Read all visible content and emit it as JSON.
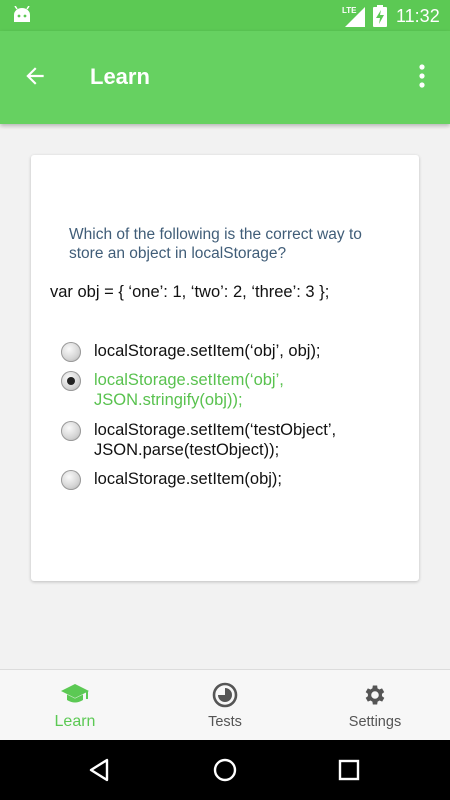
{
  "status_bar": {
    "network": "LTE",
    "time": "11:32",
    "icons": [
      "android-debug-icon",
      "lte-signal-icon",
      "battery-charging-icon"
    ]
  },
  "app_bar": {
    "title": "Learn",
    "icons": [
      "back-arrow-icon",
      "more-vert-icon"
    ]
  },
  "question": {
    "text": "Which of the following is the correct way to store an object in localStorage?",
    "code": "var obj = { ‘one’: 1, ‘two’: 2, ‘three’: 3 };",
    "options": [
      {
        "label": "localStorage.setItem(‘obj’, obj);",
        "selected": false
      },
      {
        "label": "localStorage.setItem(‘obj’, JSON.stringify(obj));",
        "selected": true
      },
      {
        "label": "localStorage.setItem(‘testObject’, JSON.parse(testObject));",
        "selected": false
      },
      {
        "label": "localStorage.setItem(obj);",
        "selected": false
      }
    ]
  },
  "bottom_nav": {
    "items": [
      {
        "label": "Learn",
        "icon": "graduation-cap-icon",
        "active": true
      },
      {
        "label": "Tests",
        "icon": "timer-icon",
        "active": false
      },
      {
        "label": "Settings",
        "icon": "gear-icon",
        "active": false
      }
    ]
  },
  "system_nav": {
    "icons": [
      "back-triangle-icon",
      "home-circle-icon",
      "recents-square-icon"
    ]
  },
  "colors": {
    "status_bar": "#5cc954",
    "app_bar": "#66d161",
    "accent_green": "#59c24f",
    "question_text": "#405d78"
  }
}
